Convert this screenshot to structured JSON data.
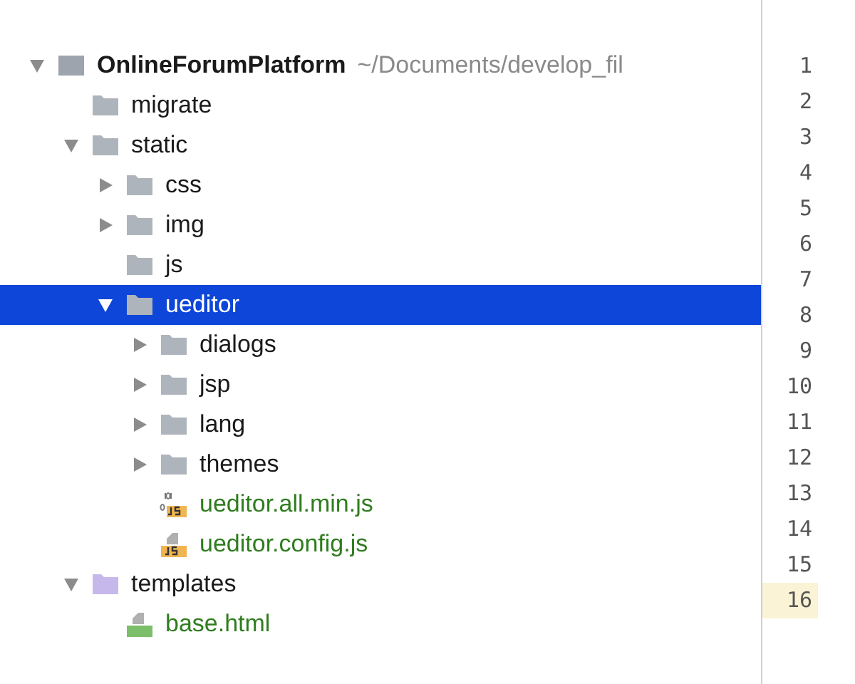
{
  "tree": [
    {
      "kind": "module",
      "name": "OnlineForumPlatform",
      "path": "~/Documents/develop_fil",
      "expanded": true,
      "selected": false,
      "added": false,
      "children": [
        {
          "kind": "folder",
          "name": "migrate",
          "selected": false,
          "added": false,
          "color": "#aeb4bc"
        },
        {
          "kind": "folder",
          "name": "static",
          "expanded": true,
          "selected": false,
          "added": false,
          "color": "#aeb4bc",
          "children": [
            {
              "kind": "folder",
              "name": "css",
              "expanded": false,
              "selected": false,
              "added": false,
              "color": "#aeb4bc"
            },
            {
              "kind": "folder",
              "name": "img",
              "expanded": false,
              "selected": false,
              "added": false,
              "color": "#aeb4bc"
            },
            {
              "kind": "folder",
              "name": "js",
              "selected": false,
              "added": false,
              "color": "#aeb4bc"
            },
            {
              "kind": "folder",
              "name": "ueditor",
              "expanded": true,
              "selected": true,
              "color": "#aeb4bc",
              "children": [
                {
                  "kind": "folder",
                  "name": "dialogs",
                  "expanded": false,
                  "selected": false,
                  "added": false,
                  "color": "#aeb4bc"
                },
                {
                  "kind": "folder",
                  "name": "jsp",
                  "expanded": false,
                  "selected": false,
                  "added": false,
                  "color": "#aeb4bc"
                },
                {
                  "kind": "folder",
                  "name": "lang",
                  "expanded": false,
                  "selected": false,
                  "added": false,
                  "color": "#aeb4bc"
                },
                {
                  "kind": "folder",
                  "name": "themes",
                  "expanded": false,
                  "selected": false,
                  "added": false,
                  "color": "#aeb4bc"
                },
                {
                  "kind": "minjs",
                  "name": "ueditor.all.min.js",
                  "selected": false,
                  "added": true
                },
                {
                  "kind": "js",
                  "name": "ueditor.config.js",
                  "selected": false,
                  "added": true
                }
              ]
            }
          ]
        },
        {
          "kind": "folder",
          "name": "templates",
          "expanded": true,
          "selected": false,
          "added": false,
          "color": "#c7b8ec",
          "children": [
            {
              "kind": "html",
              "name": "base.html",
              "selected": false,
              "added": true
            }
          ]
        }
      ]
    }
  ],
  "gutter": [
    {
      "number": "1",
      "current": false
    },
    {
      "number": "2",
      "current": false
    },
    {
      "number": "3",
      "current": false
    },
    {
      "number": "4",
      "current": false
    },
    {
      "number": "5",
      "current": false
    },
    {
      "number": "6",
      "current": false
    },
    {
      "number": "7",
      "current": false
    },
    {
      "number": "8",
      "current": false
    },
    {
      "number": "9",
      "current": false
    },
    {
      "number": "10",
      "current": false
    },
    {
      "number": "11",
      "current": false
    },
    {
      "number": "12",
      "current": false
    },
    {
      "number": "13",
      "current": false
    },
    {
      "number": "14",
      "current": false
    },
    {
      "number": "15",
      "current": false
    },
    {
      "number": "16",
      "current": true
    }
  ]
}
